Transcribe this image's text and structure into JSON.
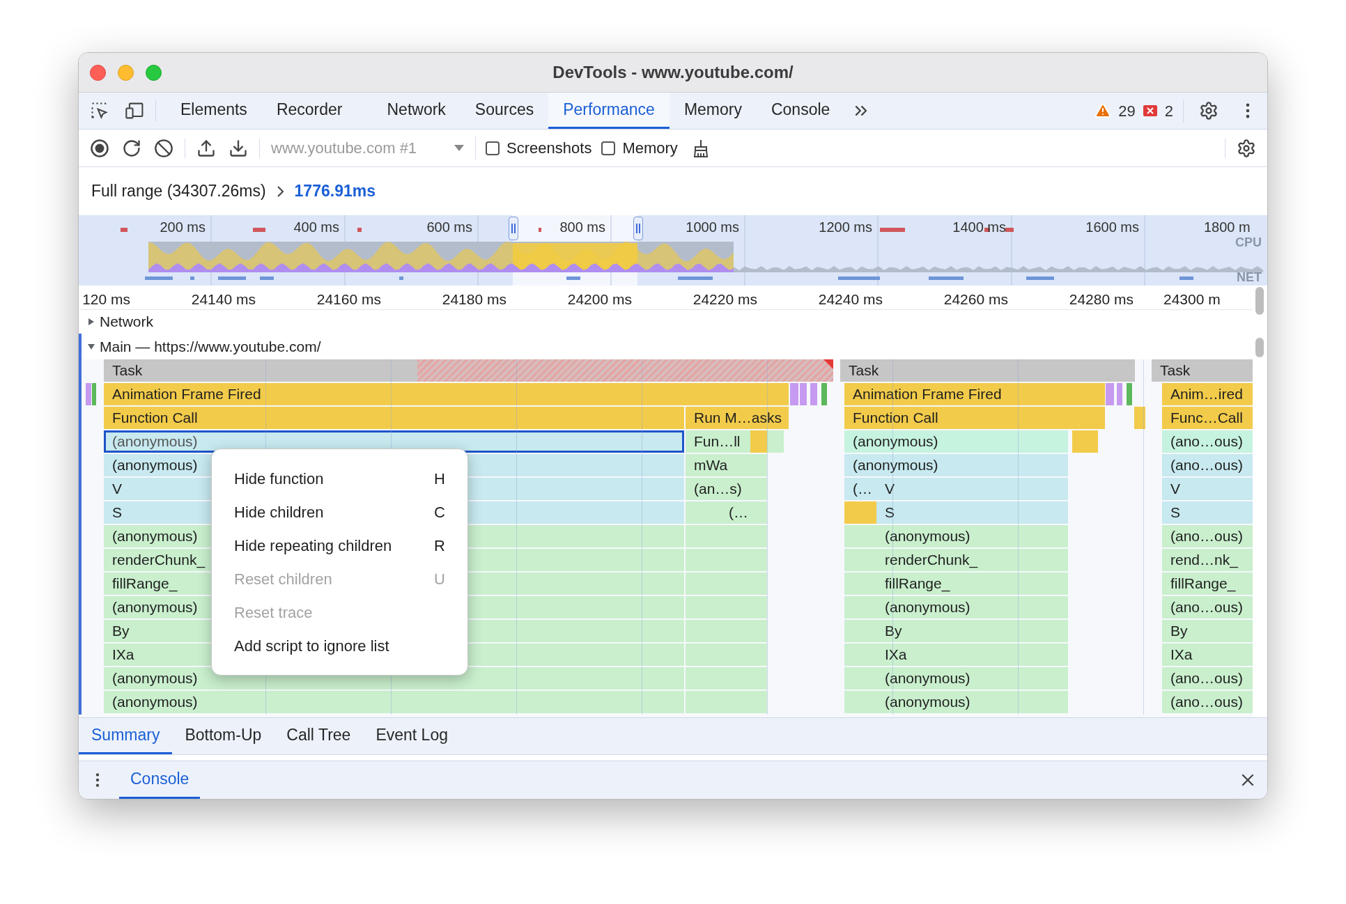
{
  "window": {
    "title": "DevTools - www.youtube.com/"
  },
  "tabs": [
    {
      "label": "Elements",
      "selected": false
    },
    {
      "label": "Recorder",
      "selected": false
    },
    {
      "label": "Network",
      "selected": false
    },
    {
      "label": "Sources",
      "selected": false
    },
    {
      "label": "Performance",
      "selected": true
    },
    {
      "label": "Memory",
      "selected": false
    },
    {
      "label": "Console",
      "selected": false
    }
  ],
  "issues": {
    "warnings": "29",
    "errors": "2"
  },
  "toolbar": {
    "target": {
      "value": "www.youtube.com #1",
      "disabled": true
    },
    "checkboxes": [
      {
        "label": "Screenshots",
        "checked": false
      },
      {
        "label": "Memory",
        "checked": false
      }
    ]
  },
  "breadcrumb": {
    "full_range": "Full range (34307.26ms)",
    "current": "1776.91ms"
  },
  "overview": {
    "labels": [
      "200 ms",
      "400 ms",
      "600 ms",
      "800 ms",
      "1000 ms",
      "1200 ms",
      "1400 ms",
      "1600 ms",
      "1800 m"
    ],
    "track_labels": [
      "CPU",
      "NET"
    ]
  },
  "ruler": [
    "120 ms",
    "24140 ms",
    "24160 ms",
    "24180 ms",
    "24200 ms",
    "24220 ms",
    "24240 ms",
    "24260 ms",
    "24280 ms",
    "24300 m"
  ],
  "tracks": [
    {
      "label": "Network",
      "expanded": false
    },
    {
      "label": "Main — https://www.youtube.com/",
      "expanded": true
    }
  ],
  "flame_rows": [
    {
      "blocks": [
        {
          "label": "Task",
          "kind": "task",
          "long_task": true,
          "selected": false
        },
        {
          "label": "Task",
          "kind": "task",
          "long_task": false,
          "selected": false
        },
        {
          "label": "Task",
          "kind": "task",
          "long_task": false,
          "selected": false
        }
      ]
    },
    {
      "blocks": [
        {
          "label": "Animation Frame Fired",
          "kind": "script",
          "selected": false
        },
        {
          "label": "Animation Frame Fired",
          "kind": "script",
          "selected": false
        },
        {
          "label": "Anim…ired",
          "kind": "script",
          "selected": false
        }
      ]
    },
    {
      "blocks": [
        {
          "label": "Function Call",
          "kind": "script",
          "selected": false
        },
        {
          "label": "Run M…asks",
          "kind": "script",
          "selected": false
        },
        {
          "label": "Function Call",
          "kind": "script",
          "selected": false
        },
        {
          "label": "Func…Call",
          "kind": "script",
          "selected": false
        }
      ]
    },
    {
      "blocks": [
        {
          "label": "(anonymous)",
          "kind": "blue",
          "selected": true
        },
        {
          "label": "Fun…ll",
          "kind": "green",
          "selected": false
        },
        {
          "label": "(anonymous)",
          "kind": "mint",
          "selected": false
        },
        {
          "label": "(ano…ous)",
          "kind": "mint",
          "selected": false
        }
      ]
    },
    {
      "blocks": [
        {
          "label": "(anonymous)",
          "kind": "blue",
          "selected": false
        },
        {
          "label": "mWa",
          "kind": "green",
          "selected": false
        },
        {
          "label": "(anonymous)",
          "kind": "blue",
          "selected": false
        },
        {
          "label": "(ano…ous)",
          "kind": "blue",
          "selected": false
        }
      ]
    },
    {
      "blocks": [
        {
          "label": "V",
          "kind": "blue",
          "selected": false
        },
        {
          "label": "(an…s)",
          "kind": "green",
          "selected": false
        },
        {
          "label": "(…",
          "kind": "blue",
          "selected": false
        },
        {
          "label": "V",
          "kind": "blue",
          "selected": false
        },
        {
          "label": "V",
          "kind": "blue",
          "selected": false
        }
      ]
    },
    {
      "blocks": [
        {
          "label": "S",
          "kind": "blue",
          "selected": false
        },
        {
          "label": "(…",
          "kind": "green",
          "selected": false
        },
        {
          "label": "S",
          "kind": "blue",
          "selected": false
        },
        {
          "label": "S",
          "kind": "blue",
          "selected": false
        }
      ]
    },
    {
      "blocks": [
        {
          "label": "(anonymous)",
          "kind": "green",
          "selected": false
        },
        {
          "label": "(anonymous)",
          "kind": "green",
          "selected": false
        },
        {
          "label": "(ano…ous)",
          "kind": "green",
          "selected": false
        }
      ]
    },
    {
      "blocks": [
        {
          "label": "renderChunk_",
          "kind": "green",
          "selected": false
        },
        {
          "label": "renderChunk_",
          "kind": "green",
          "selected": false
        },
        {
          "label": "rend…nk_",
          "kind": "green",
          "selected": false
        }
      ]
    },
    {
      "blocks": [
        {
          "label": "fillRange_",
          "kind": "green",
          "selected": false
        },
        {
          "label": "fillRange_",
          "kind": "green",
          "selected": false
        },
        {
          "label": "fillRange_",
          "kind": "green",
          "selected": false
        }
      ]
    },
    {
      "blocks": [
        {
          "label": "(anonymous)",
          "kind": "green",
          "selected": false
        },
        {
          "label": "(anonymous)",
          "kind": "green",
          "selected": false
        },
        {
          "label": "(ano…ous)",
          "kind": "green",
          "selected": false
        }
      ]
    },
    {
      "blocks": [
        {
          "label": "By",
          "kind": "green",
          "selected": false
        },
        {
          "label": "By",
          "kind": "green",
          "selected": false
        },
        {
          "label": "By",
          "kind": "green",
          "selected": false
        }
      ]
    },
    {
      "blocks": [
        {
          "label": "IXa",
          "kind": "green",
          "selected": false
        },
        {
          "label": "IXa",
          "kind": "green",
          "selected": false
        },
        {
          "label": "IXa",
          "kind": "green",
          "selected": false
        }
      ]
    },
    {
      "blocks": [
        {
          "label": "(anonymous)",
          "kind": "green",
          "selected": false
        },
        {
          "label": "(anonymous)",
          "kind": "green",
          "selected": false
        },
        {
          "label": "(ano…ous)",
          "kind": "green",
          "selected": false
        }
      ]
    },
    {
      "blocks": [
        {
          "label": "(anonymous)",
          "kind": "green",
          "selected": false
        },
        {
          "label": "(anonymous)",
          "kind": "green",
          "selected": false
        },
        {
          "label": "(ano…ous)",
          "kind": "green",
          "selected": false
        }
      ]
    }
  ],
  "context_menu": [
    {
      "label": "Hide function",
      "shortcut": "H",
      "disabled": false
    },
    {
      "label": "Hide children",
      "shortcut": "C",
      "disabled": false
    },
    {
      "label": "Hide repeating children",
      "shortcut": "R",
      "disabled": false
    },
    {
      "label": "Reset children",
      "shortcut": "U",
      "disabled": true
    },
    {
      "label": "Reset trace",
      "disabled": true
    },
    {
      "label": "Add script to ignore list",
      "disabled": false
    }
  ],
  "bottom_tabs": [
    {
      "label": "Summary",
      "selected": true
    },
    {
      "label": "Bottom-Up",
      "selected": false
    },
    {
      "label": "Call Tree",
      "selected": false
    },
    {
      "label": "Event Log",
      "selected": false
    }
  ],
  "drawer": {
    "tabs": [
      {
        "label": "Console",
        "selected": true
      }
    ]
  }
}
